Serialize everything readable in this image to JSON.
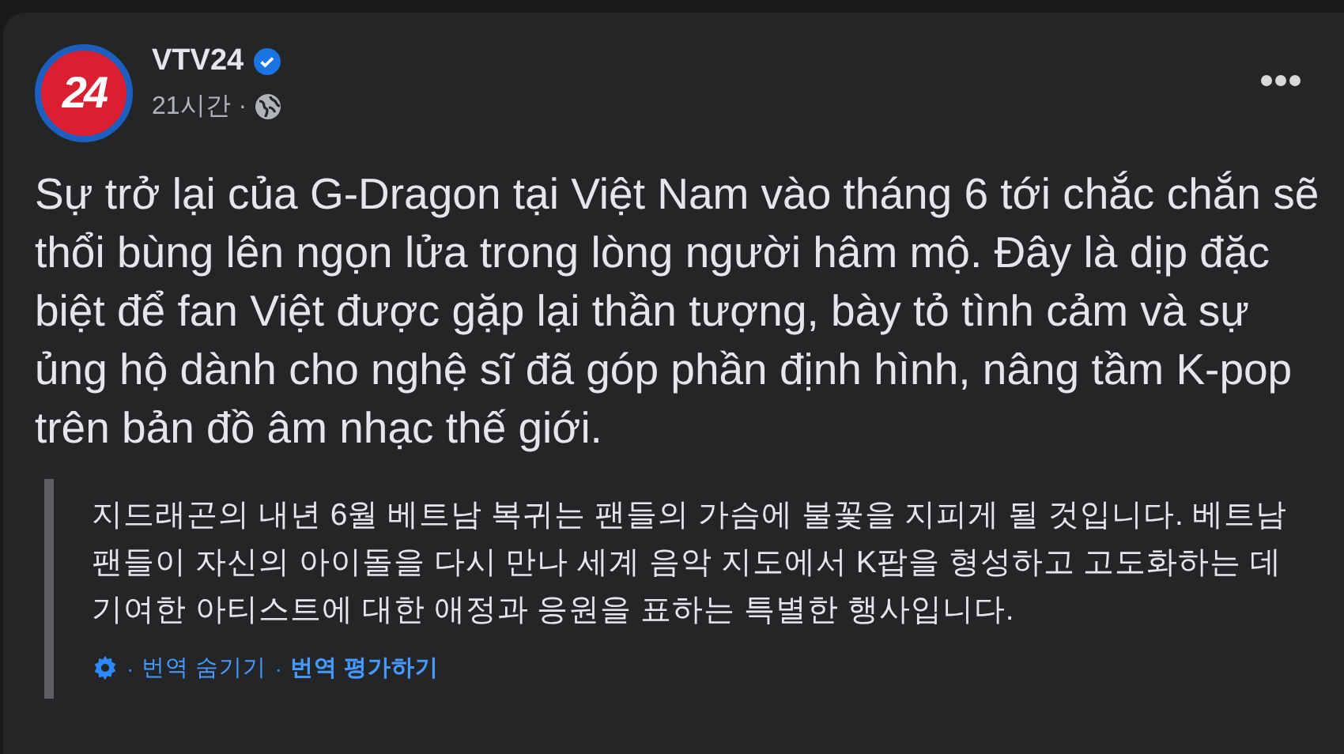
{
  "post": {
    "author": "VTV24",
    "verified": true,
    "avatar_text": "24",
    "time": "21시간",
    "separator": "·",
    "body": "Sự trở lại của G-Dragon tại Việt Nam vào tháng 6 tới chắc chắn sẽ thổi bùng lên ngọn lửa trong lòng người hâm mộ. Đây là dịp đặc biệt để fan Việt được gặp lại thần tượng, bày tỏ tình cảm và sự ủng hộ dành cho nghệ sĩ đã góp phần định hình, nâng tầm K-pop trên bản đồ âm nhạc thế giới."
  },
  "translation": {
    "text": "지드래곤의 내년 6월 베트남 복귀는 팬들의 가슴에 불꽃을 지피게 될 것입니다. 베트남 팬들이 자신의 아이돌을 다시 만나 세계 음악 지도에서 K팝을 형성하고 고도화하는 데 기여한 아티스트에 대한 애정과 응원을 표하는 특별한 행사입니다.",
    "separator": "·",
    "links": [
      {
        "label": "번역 숨기기",
        "bold": false
      },
      {
        "label": "번역 평가하기",
        "bold": true
      }
    ]
  }
}
